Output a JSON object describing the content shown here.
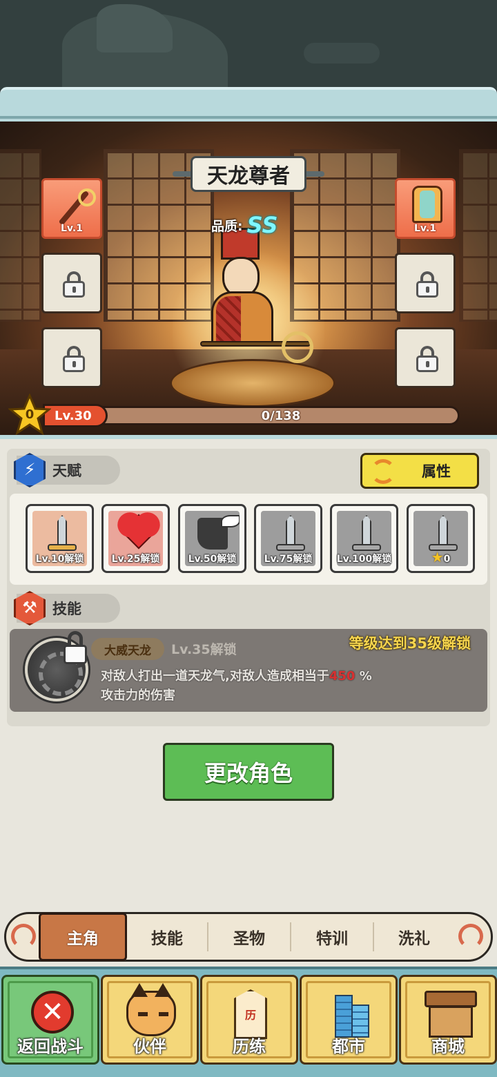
{
  "hero": {
    "name": "天龙尊者",
    "quality_label": "品质:",
    "quality_value": "SS",
    "level": "Lv.30",
    "stars": "0",
    "exp_text": "0/138",
    "exp_fraction": 0
  },
  "equipment": {
    "weapon": {
      "icon": "staff-icon",
      "level": "Lv.1"
    },
    "armor": {
      "icon": "robe-icon",
      "level": "Lv.1"
    }
  },
  "talent": {
    "title": "天赋",
    "attr_button": "属性",
    "items": [
      {
        "icon": "sword-icon",
        "label": "Lv.10解锁"
      },
      {
        "icon": "heart-icon",
        "label": "Lv.25解锁"
      },
      {
        "icon": "winged-boot-icon",
        "label": "Lv.50解锁"
      },
      {
        "icon": "sword-icon",
        "label": "Lv.75解锁"
      },
      {
        "icon": "sword-icon",
        "label": "Lv.100解锁"
      },
      {
        "icon": "sword-icon",
        "label": "0"
      }
    ]
  },
  "skill": {
    "title": "技能",
    "name": "大威天龙",
    "req_small": "Lv.35解锁",
    "req_big": "等级达到35级解锁",
    "desc_before": "对敌人打出一道天龙气,对敌人造成相当于",
    "desc_value": "450",
    "desc_after": "%",
    "desc_line2": "攻击力的伤害"
  },
  "change_button": "更改角色",
  "sub_tabs": [
    "主角",
    "技能",
    "圣物",
    "特训",
    "洗礼"
  ],
  "bottom_nav": [
    "返回战斗",
    "伙伴",
    "历练",
    "都市",
    "商城"
  ],
  "book_char": "历"
}
